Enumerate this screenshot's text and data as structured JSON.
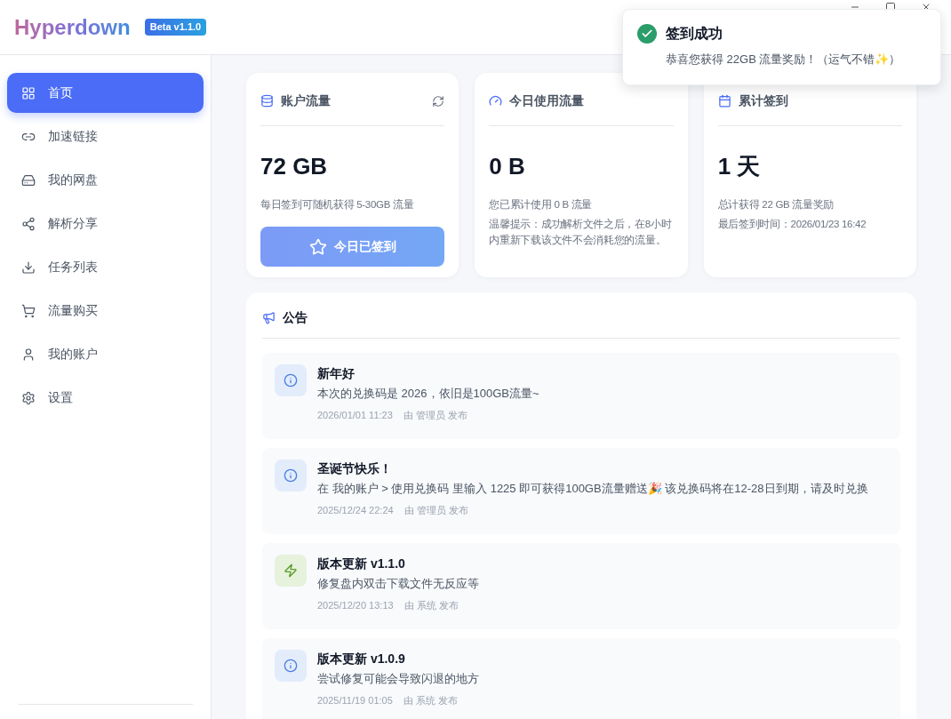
{
  "app": {
    "logo": "Hyperdown",
    "version_badge": "Beta v1.1.0"
  },
  "sidebar": {
    "items": [
      {
        "kind": "grid",
        "label": "首页",
        "selected": true
      },
      {
        "kind": "link",
        "label": "加速链接",
        "selected": false
      },
      {
        "kind": "drive",
        "label": "我的网盘",
        "selected": false
      },
      {
        "kind": "share",
        "label": "解析分享",
        "selected": false
      },
      {
        "kind": "download",
        "label": "任务列表",
        "selected": false
      },
      {
        "kind": "cart",
        "label": "流量购买",
        "selected": false
      },
      {
        "kind": "user",
        "label": "我的账户",
        "selected": false
      },
      {
        "kind": "gear",
        "label": "设置",
        "selected": false
      }
    ]
  },
  "cards": [
    {
      "kind": "database",
      "title": "账户流量",
      "refreshable": true,
      "value": "72 GB",
      "lines": [
        "每日签到可随机获得 5-30GB 流量"
      ],
      "button": {
        "label": "今日已签到",
        "disabled": true
      }
    },
    {
      "kind": "gauge",
      "title": "今日使用流量",
      "refreshable": false,
      "value": "0 B",
      "lines": [
        "您已累计使用 0 B 流量",
        "温馨提示：成功解析文件之后，在8小时内重新下载该文件不会消耗您的流量。"
      ]
    },
    {
      "kind": "calendar",
      "title": "累计签到",
      "refreshable": false,
      "value": "1 天",
      "lines": [
        "总计获得 22 GB 流量奖励",
        "最后签到时间：2026/01/23 16:42"
      ]
    }
  ],
  "announcements": {
    "title": "公告",
    "items": [
      {
        "kind": "info",
        "title": "新年好",
        "body": "本次的兑换码是 2026，依旧是100GB流量~",
        "time": "2026/01/01 11:23",
        "author": "由 管理员 发布"
      },
      {
        "kind": "info",
        "title": "圣诞节快乐！",
        "body": "在 我的账户 > 使用兑换码 里输入 1225 即可获得100GB流量赠送🎉 该兑换码将在12-28日到期，请及时兑换",
        "time": "2025/12/24 22:24",
        "author": "由 管理员 发布"
      },
      {
        "kind": "bolt",
        "title": "版本更新 v1.1.0",
        "body": "修复盘内双击下载文件无反应等",
        "time": "2025/12/20 13:13",
        "author": "由 系统 发布"
      },
      {
        "kind": "info",
        "title": "版本更新 v1.0.9",
        "body": "尝试修复可能会导致闪退的地方",
        "time": "2025/11/19 01:05",
        "author": "由 系统 发布"
      }
    ]
  },
  "toast": {
    "kind": "success",
    "title": "签到成功",
    "message": "恭喜您获得 22GB 流量奖励！（运气不错✨）"
  }
}
